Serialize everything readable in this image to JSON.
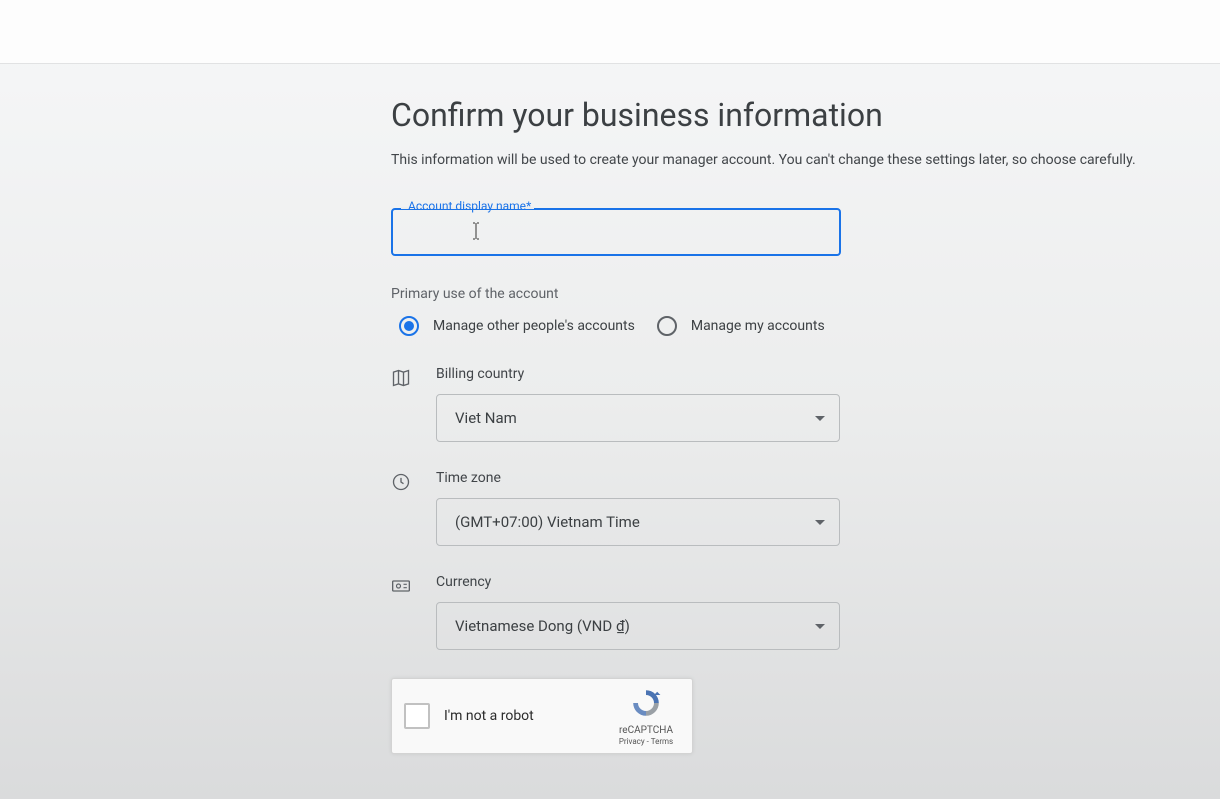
{
  "title": "Confirm your business information",
  "subtitle": "This information will be used to create your manager account. You can't change these settings later, so choose carefully.",
  "account_name": {
    "label": "Account display name",
    "required_marker": "*",
    "value": ""
  },
  "primary_use": {
    "label": "Primary use of the account",
    "options": [
      {
        "label": "Manage other people's accounts",
        "selected": true
      },
      {
        "label": "Manage my accounts",
        "selected": false
      }
    ]
  },
  "billing_country": {
    "label": "Billing country",
    "value": "Viet Nam"
  },
  "time_zone": {
    "label": "Time zone",
    "value": "(GMT+07:00) Vietnam Time"
  },
  "currency": {
    "label": "Currency",
    "value": "Vietnamese Dong (VND ₫)"
  },
  "recaptcha": {
    "label": "I'm not a robot",
    "brand": "reCAPTCHA",
    "privacy": "Privacy",
    "separator": " - ",
    "terms": "Terms"
  }
}
